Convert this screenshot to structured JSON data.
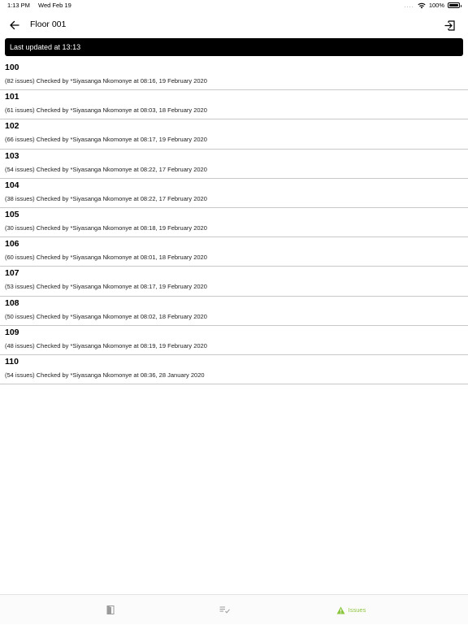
{
  "status_bar": {
    "time": "1:13 PM",
    "date": "Wed Feb 19",
    "signal_dots": "....",
    "battery": "100%"
  },
  "header": {
    "title": "Floor 001"
  },
  "banner": {
    "text": "Last updated at 13:13"
  },
  "rooms": [
    {
      "number": "100",
      "detail": "(82 issues) Checked by *Siyasanga Nkomonye at 08:16, 19 February 2020"
    },
    {
      "number": "101",
      "detail": "(61 issues) Checked by *Siyasanga Nkomonye at 08:03, 18 February 2020"
    },
    {
      "number": "102",
      "detail": "(66 issues) Checked by *Siyasanga Nkomonye at 08:17, 19 February 2020"
    },
    {
      "number": "103",
      "detail": "(54 issues) Checked by *Siyasanga Nkomonye at 08:22, 17 February 2020"
    },
    {
      "number": "104",
      "detail": "(38 issues) Checked by *Siyasanga Nkomonye at 08:22, 17 February 2020"
    },
    {
      "number": "105",
      "detail": "(30 issues) Checked by *Siyasanga Nkomonye at 08:18, 19 February 2020"
    },
    {
      "number": "106",
      "detail": "(60 issues) Checked by *Siyasanga Nkomonye at 08:01, 18 February 2020"
    },
    {
      "number": "107",
      "detail": "(53 issues) Checked by *Siyasanga Nkomonye at 08:17, 19 February 2020"
    },
    {
      "number": "108",
      "detail": "(50 issues) Checked by *Siyasanga Nkomonye at 08:02, 18 February 2020"
    },
    {
      "number": "109",
      "detail": "(48 issues) Checked by *Siyasanga Nkomonye at 08:19, 19 February 2020"
    },
    {
      "number": "110",
      "detail": "(54 issues) Checked by *Siyasanga Nkomonye at 08:36, 28 January 2020"
    }
  ],
  "tab_bar": {
    "tabs": [
      {
        "icon": "door-icon",
        "label": ""
      },
      {
        "icon": "checklist-icon",
        "label": ""
      },
      {
        "icon": "warning-icon",
        "label": "Issues"
      }
    ]
  },
  "colors": {
    "accent": "#8cc63f",
    "banner_bg": "#000000",
    "divider": "#c8c8c8"
  }
}
